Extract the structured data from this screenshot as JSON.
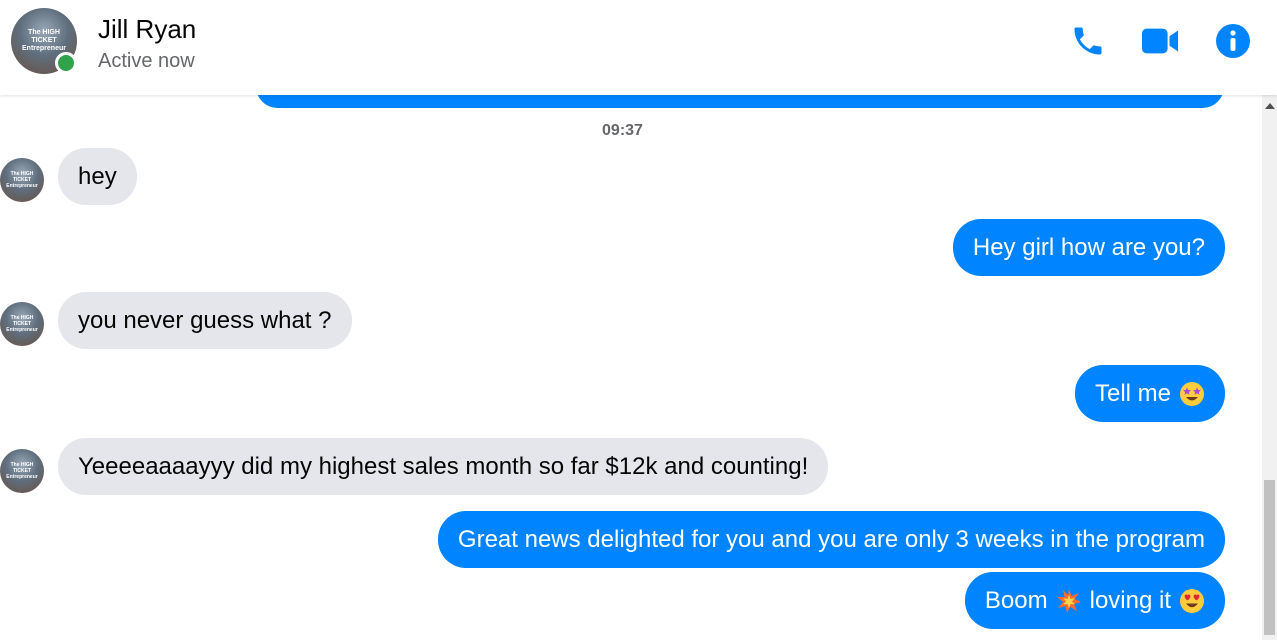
{
  "header": {
    "name": "Jill Ryan",
    "status": "Active now",
    "avatar_text": [
      "The HIGH",
      "TICKET",
      "Entrepreneur"
    ]
  },
  "colors": {
    "accent": "#0084ff",
    "incoming_bubble": "#e4e6eb",
    "online": "#31a24c"
  },
  "icons": {
    "call": "phone-icon",
    "video": "video-camera-icon",
    "info": "info-icon"
  },
  "chat": {
    "timestamp": "09:37",
    "messages": [
      {
        "side": "in",
        "text": "hey"
      },
      {
        "side": "out",
        "text": "Hey girl how are you?"
      },
      {
        "side": "in",
        "text": "you never guess what ?"
      },
      {
        "side": "out",
        "text": "Tell me",
        "emoji": "star-struck-emoji"
      },
      {
        "side": "in",
        "text": "Yeeeeaaaayyy did my highest sales month so far $12k and counting!"
      },
      {
        "side": "out",
        "text": "Great news delighted for you and you are only 3 weeks in the program"
      },
      {
        "side": "out",
        "text": "Boom",
        "emoji": "collision-emoji",
        "text2": "loving it",
        "emoji2": "heart-eyes-emoji"
      }
    ]
  }
}
